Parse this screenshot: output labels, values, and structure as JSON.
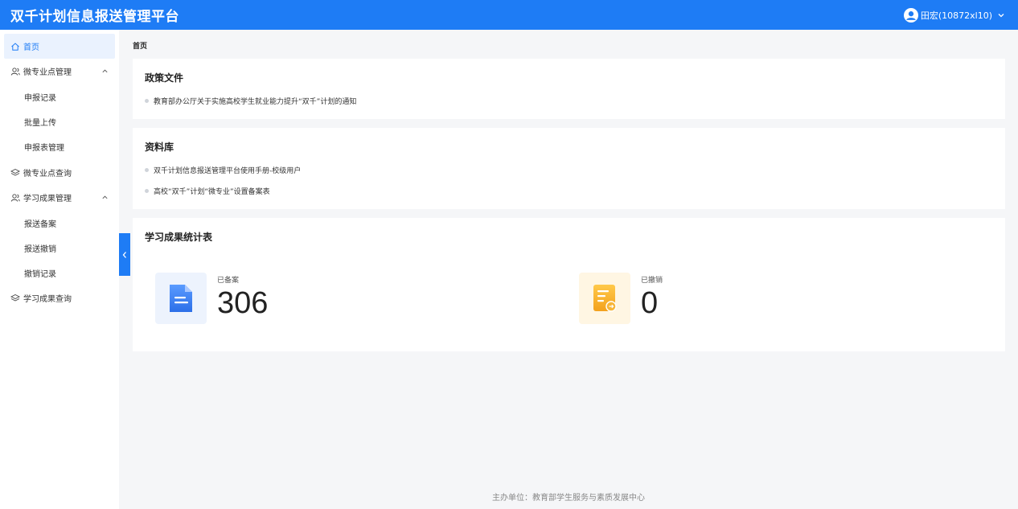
{
  "header": {
    "title": "双千计划信息报送管理平台",
    "user_name": "田宏(10872xl10)",
    "brand_color": "#1e7cf5"
  },
  "sidebar": {
    "items": [
      {
        "label": "首页",
        "icon": "home-icon",
        "active": true
      },
      {
        "label": "微专业点管理",
        "icon": "user-group-icon",
        "expanded": true
      },
      {
        "label": "申报记录"
      },
      {
        "label": "批量上传"
      },
      {
        "label": "申报表管理"
      },
      {
        "label": "微专业点查询",
        "icon": "layers-icon"
      },
      {
        "label": "学习成果管理",
        "icon": "user-group-icon",
        "expanded": true
      },
      {
        "label": "报送备案"
      },
      {
        "label": "报送撤销"
      },
      {
        "label": "撤销记录"
      },
      {
        "label": "学习成果查询",
        "icon": "layers-icon"
      }
    ]
  },
  "breadcrumb": "首页",
  "policy": {
    "title": "政策文件",
    "items": [
      "教育部办公厅关于实施高校学生就业能力提升“双千”计划的通知"
    ]
  },
  "library": {
    "title": "资料库",
    "items": [
      "双千计划信息报送管理平台使用手册-校级用户",
      "高校“双千”计划“微专业”设置备案表"
    ]
  },
  "stats": {
    "title": "学习成果统计表",
    "filed": {
      "label": "已备案",
      "value": "306",
      "icon": "document-icon"
    },
    "revoked": {
      "label": "已撤销",
      "value": "0",
      "icon": "document-revoke-icon"
    }
  },
  "footer": "主办单位：教育部学生服务与素质发展中心"
}
